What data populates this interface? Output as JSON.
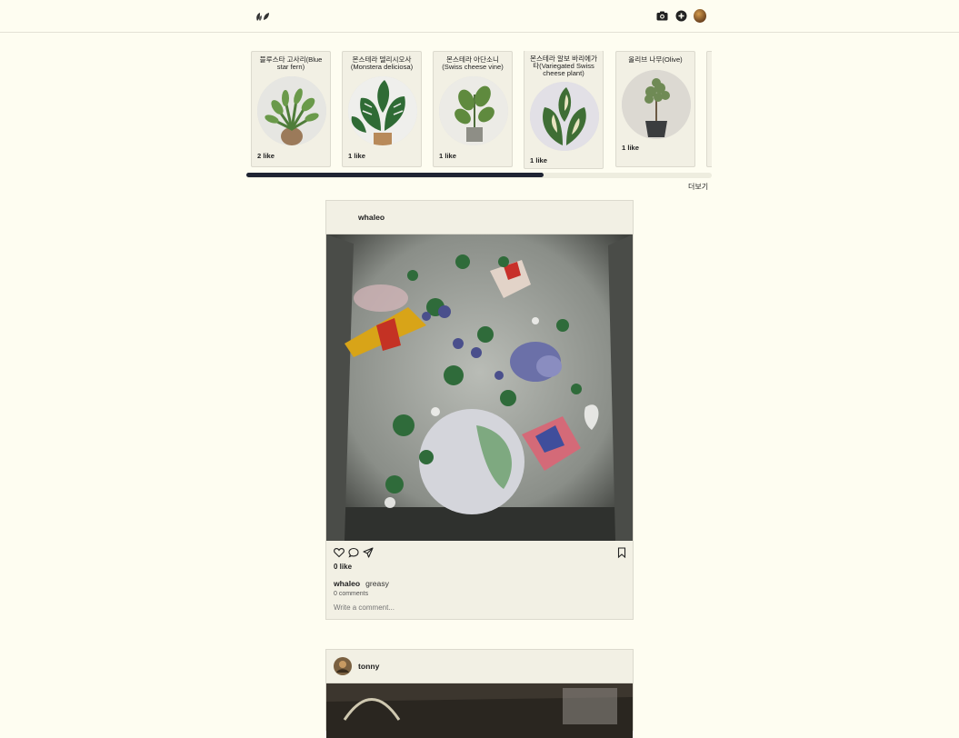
{
  "header": {
    "logo": "leaf-logo",
    "icons": [
      "camera-icon",
      "add-post-icon",
      "profile-avatar"
    ]
  },
  "plants": [
    {
      "name": "블루스타 고사리(Blue star fern)",
      "likes": "2 like"
    },
    {
      "name": "몬스테라 델리시오사(Monstera deliciosa)",
      "likes": "1 like"
    },
    {
      "name": "몬스테라 아단소니(Swiss cheese vine)",
      "likes": "1 like"
    },
    {
      "name": "몬스테라 알보 바리에가타(Variegated Swiss cheese plant)",
      "likes": "1 like"
    },
    {
      "name": "올리브 나무(Olive)",
      "likes": "1 like"
    }
  ],
  "carousel": {
    "more_label": "더보기"
  },
  "posts": [
    {
      "username": "whaleo",
      "likes": "0 like",
      "caption_user": "whaleo",
      "caption": "greasy",
      "comments": "0 comments",
      "comment_placeholder": "Write a comment..."
    },
    {
      "username": "tonny"
    }
  ]
}
